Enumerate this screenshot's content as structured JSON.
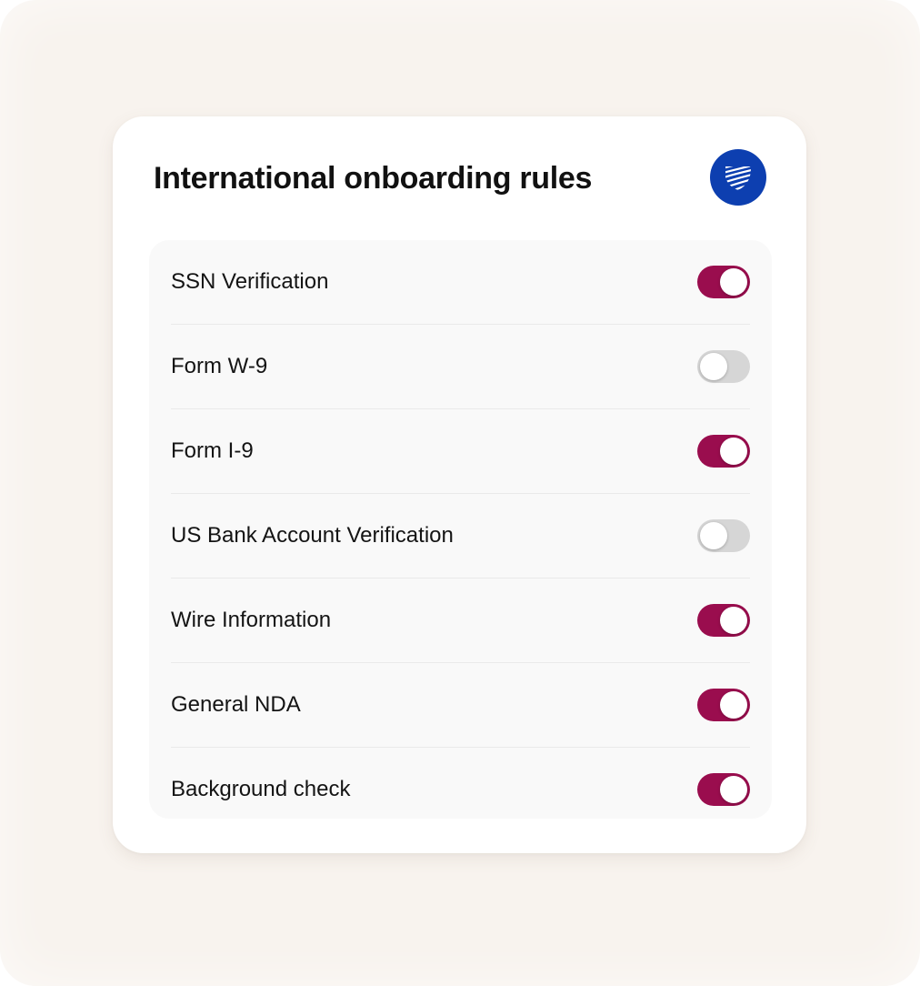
{
  "card": {
    "title": "International onboarding rules",
    "logo_icon": "striped-leaf-logo-icon",
    "logo_color": "#0d3fb0"
  },
  "colors": {
    "toggle_on": "#9a0d4e",
    "toggle_off": "#d6d6d6",
    "background": "#f8f3ee"
  },
  "rules": [
    {
      "label": "SSN Verification",
      "enabled": true
    },
    {
      "label": "Form W-9",
      "enabled": false
    },
    {
      "label": "Form I-9",
      "enabled": true
    },
    {
      "label": "US Bank Account Verification",
      "enabled": false
    },
    {
      "label": "Wire Information",
      "enabled": true
    },
    {
      "label": "General NDA",
      "enabled": true
    },
    {
      "label": "Background check",
      "enabled": true
    }
  ]
}
